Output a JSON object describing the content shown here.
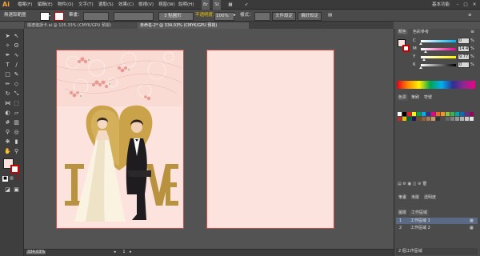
{
  "app": {
    "logo": "Ai",
    "workspace": "基本功能"
  },
  "menu": [
    "檔案(F)",
    "編輯(E)",
    "物件(O)",
    "文字(T)",
    "選取(S)",
    "效果(C)",
    "檢視(V)",
    "視窗(W)",
    "說明(H)"
  ],
  "controlbar": {
    "selection": "無選取範圍",
    "stroke_label": "筆畫：",
    "brush": "3 點圓形",
    "opacity_label": "不透明度：",
    "opacity_value": "100%",
    "style_label": "樣式：",
    "document_setup": "文件設定",
    "preferences": "偏好設定"
  },
  "tabs": [
    {
      "label": "婚禮邀請卡.ai @ 105.33% (CMYK/GPU 預視)",
      "active": false
    },
    {
      "label": "未命名-2* @ 334.03% (CMYK/GPU 預視)",
      "active": true
    }
  ],
  "color_panel": {
    "title": "顏色",
    "tab2": "色彩參考",
    "channels": [
      {
        "label": "C",
        "value": "0",
        "unit": "%",
        "fraction": 0.0,
        "gradient": "linear-gradient(90deg,#fff,#00aeef)"
      },
      {
        "label": "M",
        "value": "14.45",
        "unit": "%",
        "fraction": 0.1445,
        "gradient": "linear-gradient(90deg,#fff,#ec008c)"
      },
      {
        "label": "Y",
        "value": "9.77",
        "unit": "%",
        "fraction": 0.0977,
        "gradient": "linear-gradient(90deg,#fff,#fff200)"
      },
      {
        "label": "K",
        "value": "0",
        "unit": "%",
        "fraction": 0.0,
        "gradient": "linear-gradient(90deg,#fff,#000)"
      }
    ]
  },
  "swatches_panel": {
    "tabs": [
      "色票",
      "筆刷",
      "符號"
    ]
  },
  "layers_panel": {
    "tabs": [
      "筆畫",
      "漸層",
      "透明度"
    ],
    "subtabs": [
      "圖層",
      "工作區域"
    ],
    "rows": [
      {
        "num": "1",
        "name": "工作區域 1"
      },
      {
        "num": "2",
        "name": "工作區域 2"
      }
    ],
    "footer": "2 個工作區域"
  },
  "statusbar": {
    "zoom": "334.03%",
    "page": "1"
  },
  "artboard_fill": "#fde3dd",
  "artboard_border": "#c84a4a"
}
